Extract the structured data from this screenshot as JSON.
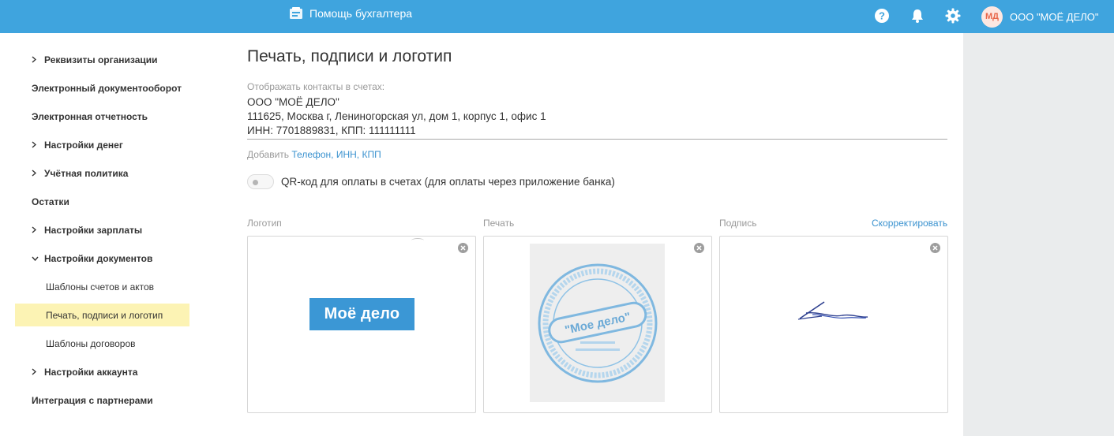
{
  "header": {
    "app_title": "Помощь бухгалтера",
    "org_initials": "МД",
    "org_name": "ООО \"МОЁ ДЕЛО\"",
    "icons": [
      "book-icon",
      "help-icon",
      "bell-icon",
      "gear-icon"
    ],
    "accent_color": "#3fa4de"
  },
  "sidebar": {
    "items": [
      {
        "label": "Реквизиты организации",
        "chevron": "right"
      },
      {
        "label": "Электронный документооборот"
      },
      {
        "label": "Электронная отчетность"
      },
      {
        "label": "Настройки денег",
        "chevron": "right"
      },
      {
        "label": "Учётная политика",
        "chevron": "right"
      },
      {
        "label": "Остатки"
      },
      {
        "label": "Настройки зарплаты",
        "chevron": "right"
      },
      {
        "label": "Настройки документов",
        "chevron": "down"
      },
      {
        "label": "Шаблоны счетов и актов",
        "sub": true
      },
      {
        "label": "Печать, подписи и логотип",
        "sub": true,
        "active": true
      },
      {
        "label": "Шаблоны договоров",
        "sub": true
      },
      {
        "label": "Настройки аккаунта",
        "chevron": "right"
      },
      {
        "label": "Интеграция с партнерами"
      }
    ],
    "active_color": "#fcf3b4"
  },
  "main": {
    "title": "Печать, подписи и логотип",
    "contacts_label": "Отображать контакты в счетах:",
    "contacts_lines": [
      "ООО \"МОЁ ДЕЛО\"",
      "111625, Москва г, Лениногорская ул, дом 1, корпус 1, офис 1",
      "ИНН: 7701889831, КПП: 111111111"
    ],
    "add_prefix": "Добавить",
    "add_link": "Телефон, ИНН, КПП",
    "qr_toggle": {
      "label": "QR-код для оплаты в счетах (для оплаты через приложение банка)",
      "on": false
    },
    "cards": {
      "logo": {
        "caption": "Логотип",
        "logo_text": "Моё дело"
      },
      "stamp": {
        "caption": "Печать",
        "stamp_text": "\"Мое дело\""
      },
      "signature": {
        "caption": "Подпись",
        "action": "Скорректировать"
      }
    }
  }
}
